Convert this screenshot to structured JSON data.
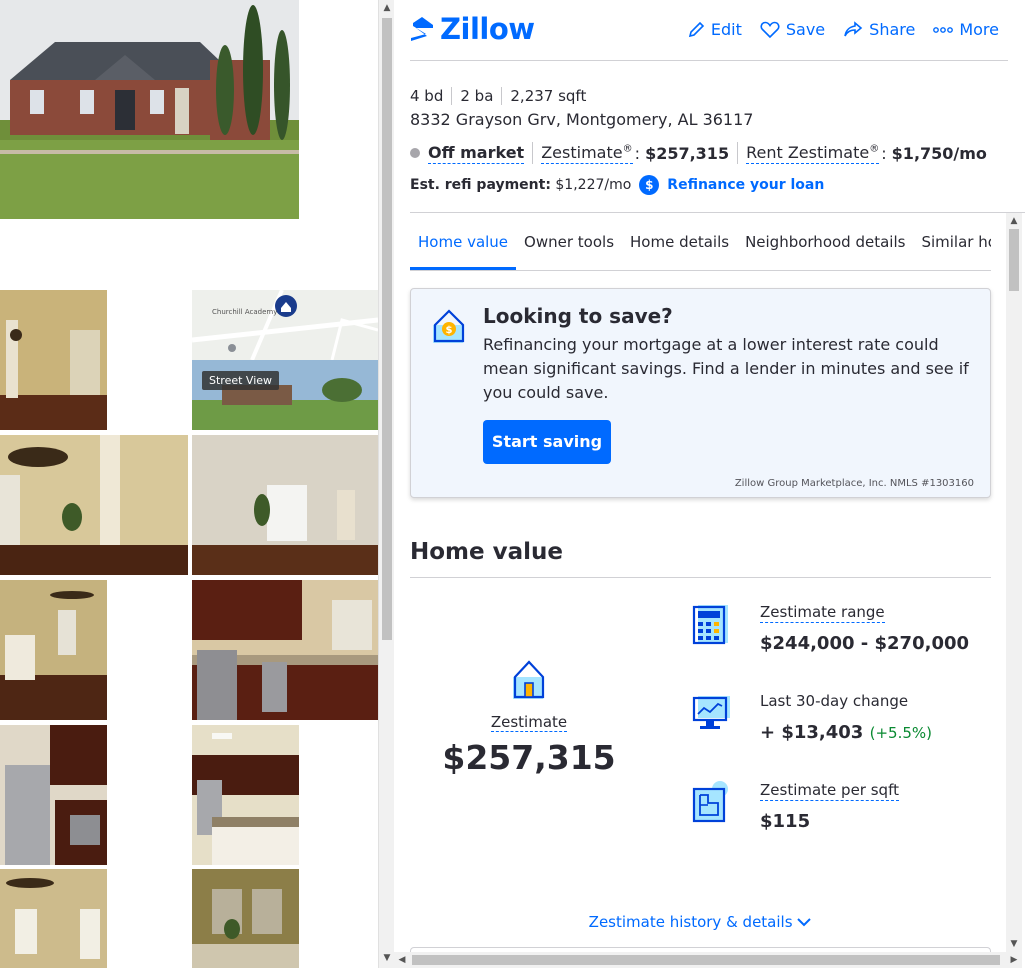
{
  "brand": {
    "name": "Zillow",
    "color": "#006aff"
  },
  "header_actions": [
    {
      "icon": "pencil-icon",
      "label": "Edit"
    },
    {
      "icon": "heart-icon",
      "label": "Save"
    },
    {
      "icon": "share-icon",
      "label": "Share"
    },
    {
      "icon": "more-dots-icon",
      "label": "More"
    }
  ],
  "listing": {
    "beds": "4 bd",
    "baths": "2 ba",
    "sqft": "2,237 sqft",
    "address": "8332 Grayson Grv, Montgomery, AL 36117",
    "status": "Off market",
    "zestimate_label": "Zestimate",
    "zestimate_reg": "®",
    "zestimate_value": "$257,315",
    "rent_label": "Rent Zestimate",
    "rent_reg": "®",
    "rent_value": "$1,750/mo",
    "refi_label": "Est. refi payment:",
    "refi_value": "$1,227/mo",
    "refi_link": "Refinance your loan"
  },
  "tabs": [
    "Home value",
    "Owner tools",
    "Home details",
    "Neighborhood details",
    "Similar homes"
  ],
  "active_tab": 0,
  "promo": {
    "title": "Looking to save?",
    "body": "Refinancing your mortgage at a lower interest rate could mean significant savings. Find a lender in minutes and see if you could save.",
    "button": "Start saving",
    "disclaimer": "Zillow Group Marketplace, Inc. NMLS #1303160"
  },
  "home_value": {
    "title": "Home value",
    "zestimate_label": "Zestimate",
    "zestimate_value": "$257,315",
    "range_label": "Zestimate range",
    "range_value": "$244,000 - $270,000",
    "change_label": "Last 30-day change",
    "change_value": "+ $13,403",
    "change_pct": "(+5.5%)",
    "sqft_label": "Zestimate per sqft",
    "sqft_value": "$115",
    "history_link": "Zestimate history & details"
  },
  "gallery": {
    "street_view_label": "Street View",
    "map_label": "Churchill Academy"
  }
}
